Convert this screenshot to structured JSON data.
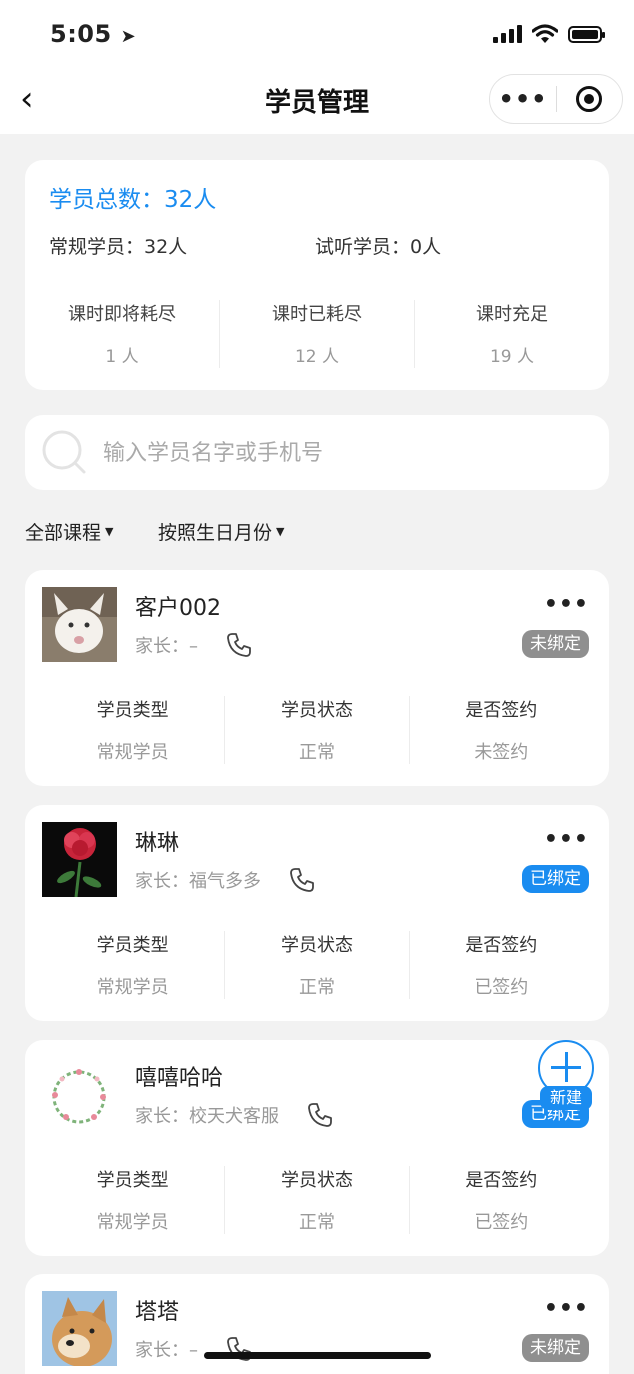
{
  "status": {
    "time": "5:05"
  },
  "nav": {
    "back": "‹",
    "title": "学员管理"
  },
  "summary": {
    "total": "学员总数：32人",
    "regular": "常规学员：32人",
    "trial": "试听学员：0人",
    "hours": [
      {
        "label": "课时即将耗尽",
        "value": "1 人"
      },
      {
        "label": "课时已耗尽",
        "value": "12 人"
      },
      {
        "label": "课时充足",
        "value": "19 人"
      }
    ]
  },
  "search": {
    "placeholder": "输入学员名字或手机号"
  },
  "filters": {
    "course": "全部课程",
    "birthday": "按照生日月份"
  },
  "students": [
    {
      "name": "客户002",
      "parent": "家长：–",
      "badge": "未绑定",
      "stats": [
        {
          "label": "学员类型",
          "value": "常规学员"
        },
        {
          "label": "学员状态",
          "value": "正常"
        },
        {
          "label": "是否签约",
          "value": "未签约"
        }
      ]
    },
    {
      "name": "琳琳",
      "parent": "家长：福气多多",
      "badge": "已绑定",
      "stats": [
        {
          "label": "学员类型",
          "value": "常规学员"
        },
        {
          "label": "学员状态",
          "value": "正常"
        },
        {
          "label": "是否签约",
          "value": "已签约"
        }
      ]
    },
    {
      "name": "嘻嘻哈哈",
      "parent": "家长：校天犬客服",
      "badge": "已绑定",
      "stats": [
        {
          "label": "学员类型",
          "value": "常规学员"
        },
        {
          "label": "学员状态",
          "value": "正常"
        },
        {
          "label": "是否签约",
          "value": "已签约"
        }
      ]
    },
    {
      "name": "塔塔",
      "parent": "家长：–",
      "badge": "未绑定"
    }
  ],
  "fab": {
    "label": "新建"
  },
  "colors": {
    "accent": "#1a8cf0",
    "unbound": "#8f8f8f",
    "background": "#f2f2f2"
  }
}
